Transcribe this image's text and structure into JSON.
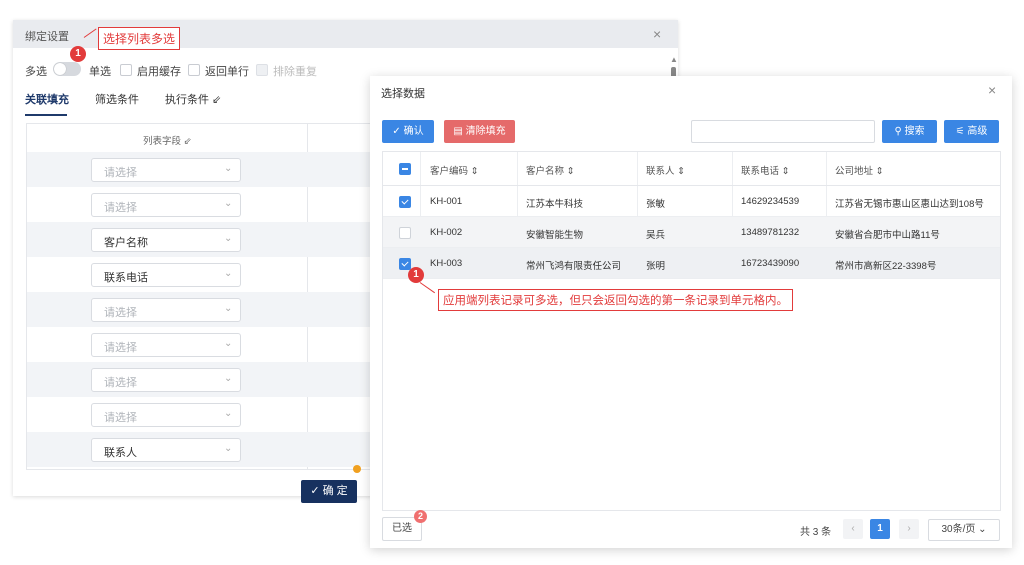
{
  "bind_dialog": {
    "title": "绑定设置",
    "close_icon": "×",
    "mode_multi": "多选",
    "mode_single": "单选",
    "options": [
      "启用缓存",
      "返回单行",
      "排除重复"
    ],
    "tabs": [
      "关联填充",
      "筛选条件",
      "执行条件 ⇙"
    ],
    "list_field_header": "列表字段 ⇙",
    "rows": [
      {
        "value": "",
        "placeholder": "请选择"
      },
      {
        "value": "",
        "placeholder": "请选择"
      },
      {
        "value": "客户名称",
        "placeholder": ""
      },
      {
        "value": "联系电话",
        "placeholder": ""
      },
      {
        "value": "",
        "placeholder": "请选择"
      },
      {
        "value": "",
        "placeholder": "请选择"
      },
      {
        "value": "",
        "placeholder": "请选择"
      },
      {
        "value": "",
        "placeholder": "请选择"
      },
      {
        "value": "联系人",
        "placeholder": ""
      }
    ],
    "confirm_label": "✓ 确 定"
  },
  "annotations": {
    "top_label": "选择列表多选",
    "top_badge": "1",
    "row_badge": "1",
    "row_note": "应用端列表记录可多选，但只会返回勾选的第一条记录到单元格内。",
    "selected_badge": "2"
  },
  "select_dialog": {
    "title": "选择数据",
    "close_icon": "×",
    "confirm_label": "✓ 确认",
    "clear_label": "▤ 清除填充",
    "search_value": "",
    "search_label": "⚲ 搜索",
    "advanced_label": "⚟ 高级",
    "columns": [
      "客户编码 ⇕",
      "客户名称 ⇕",
      "联系人 ⇕",
      "联系电话 ⇕",
      "公司地址 ⇕"
    ],
    "rows": [
      {
        "checked": true,
        "code": "KH-001",
        "name": "江苏本牛科技",
        "contact": "张敏",
        "phone": "14629234539",
        "address": "江苏省无锡市惠山区惠山达到108号"
      },
      {
        "checked": false,
        "code": "KH-002",
        "name": "安徽智能生物",
        "contact": "吴兵",
        "phone": "13489781232",
        "address": "安徽省合肥市中山路11号"
      },
      {
        "checked": true,
        "code": "KH-003",
        "name": "常州飞鸿有限责任公司",
        "contact": "张明",
        "phone": "16723439090",
        "address": "常州市高新区22-3398号"
      }
    ],
    "selected_label": "已选",
    "total_label": "共 3 条",
    "page_prev": "‹",
    "page_current": "1",
    "page_next": "›",
    "page_size": "30条/页 ⌄"
  },
  "colors": {
    "primary": "#3a86e4",
    "danger": "#e56a6a",
    "annotation": "#e23b3b",
    "dark_button": "#17315f"
  }
}
